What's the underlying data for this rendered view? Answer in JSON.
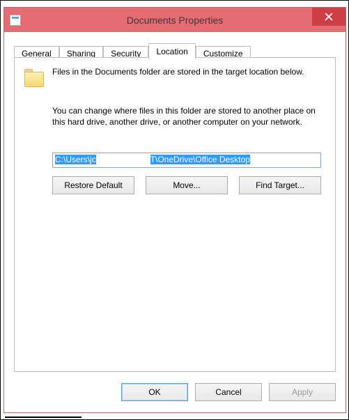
{
  "window": {
    "title": "Documents Properties"
  },
  "tabs": {
    "t0": "General",
    "t1": "Sharing",
    "t2": "Security",
    "t3": "Location",
    "t4": "Customize",
    "active": "Location"
  },
  "location": {
    "description1": "Files in the Documents folder are stored in the target location below.",
    "description2": "You can change where files in this folder are stored to another place on this hard drive, another drive, or another computer on your network.",
    "path_prefix": "C:\\Users\\jc",
    "path_suffix": "T\\OneDrive\\Office Desktop",
    "restore": "Restore Default",
    "move": "Move...",
    "find": "Find Target..."
  },
  "dialog": {
    "ok": "OK",
    "cancel": "Cancel",
    "apply": "Apply"
  }
}
